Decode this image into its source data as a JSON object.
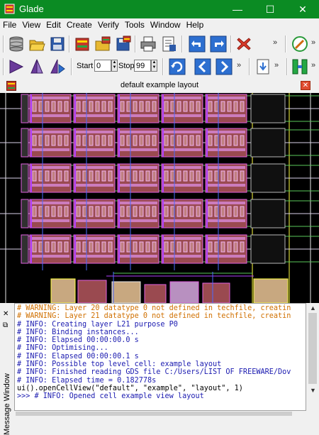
{
  "window": {
    "title": "Glade",
    "minimize_glyph": "—",
    "maximize_glyph": "☐",
    "close_glyph": "✕",
    "accent": "#0b8b23"
  },
  "menu": [
    "File",
    "View",
    "Edit",
    "Create",
    "Verify",
    "Tools",
    "Window",
    "Help"
  ],
  "toolbar1": {
    "icons": [
      "database-icon",
      "open-folder-icon",
      "save-icon",
      "library-icon",
      "open-cell-icon",
      "save-cell-icon",
      "print-icon",
      "export-icon",
      "undo-icon",
      "redo-icon",
      "delete-icon",
      "edit-icon"
    ],
    "overflow": "»"
  },
  "toolbar2": {
    "icons": [
      "flip-horizontal-icon",
      "flip-vertical-icon",
      "rotate-icon",
      "refresh-icon",
      "back-icon",
      "forward-icon",
      "download-icon",
      "zoom-fit-icon"
    ],
    "start_label": "Start",
    "start_value": "0",
    "stop_label": "Stop",
    "stop_value": "99",
    "overflow": "»"
  },
  "document": {
    "title": "default example layout",
    "close_glyph": "✕"
  },
  "console": {
    "panel_label": "Message Window",
    "lines": [
      {
        "type": "warn",
        "text": "# WARNING: Layer 20 datatype 0 not defined in techfile, creatin"
      },
      {
        "type": "warn",
        "text": "# WARNING: Layer 21 datatype 0 not defined in techfile, creatin"
      },
      {
        "type": "info",
        "text": "# INFO: Creating layer L21 purpose P0"
      },
      {
        "type": "info",
        "text": "# INFO: Binding instances..."
      },
      {
        "type": "info",
        "text": "# INFO: Elapsed 00:00:00.0 s"
      },
      {
        "type": "info",
        "text": "# INFO: Optimising..."
      },
      {
        "type": "info",
        "text": "# INFO: Elapsed 00:00:00.1 s"
      },
      {
        "type": "info",
        "text": "# INFO: Possible top level cell: example layout"
      },
      {
        "type": "info",
        "text": "# INFO: Finished reading GDS file C:/Users/LIST OF FREEWARE/Dov"
      },
      {
        "type": "info",
        "text": "# INFO: Elapsed time = 0.182778s"
      },
      {
        "type": "cmd",
        "text": "ui().openCellView(\"default\", \"example\", \"layout\", 1)"
      },
      {
        "type": "resp",
        "text": ">>> # INFO: Opened cell example view layout"
      }
    ]
  }
}
